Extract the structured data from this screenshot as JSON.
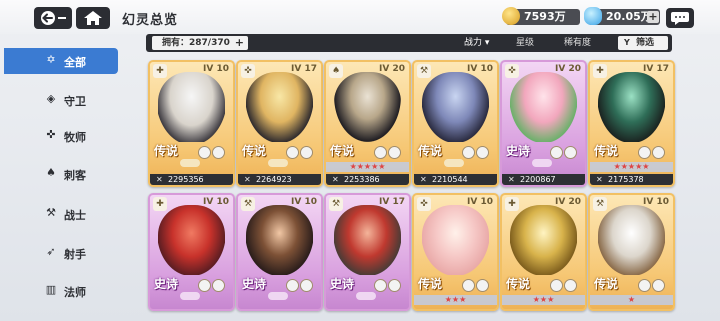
{
  "header": {
    "title": "幻灵总览",
    "gold": "7593万",
    "gems": "20.05万",
    "plus": "+"
  },
  "filter_bar": {
    "owned": "拥有：287/370",
    "owned_plus": "+",
    "power": "战力 ▾",
    "star": "星级",
    "rarity": "稀有度",
    "screen": "筛选"
  },
  "sidebar": {
    "items": [
      {
        "label": "全部",
        "icon": "✡"
      },
      {
        "label": "守卫",
        "icon": "◈"
      },
      {
        "label": "牧师",
        "icon": "✜"
      },
      {
        "label": "刺客",
        "icon": "♠"
      },
      {
        "label": "战士",
        "icon": "⚒"
      },
      {
        "label": "射手",
        "icon": "➶"
      },
      {
        "label": "法师",
        "icon": "▥"
      }
    ]
  },
  "cards": [
    {
      "level": "10",
      "rarity": "传说",
      "power": "2295356",
      "class_icon": "✚",
      "stars": ""
    },
    {
      "level": "17",
      "rarity": "传说",
      "power": "2264923",
      "class_icon": "✜",
      "stars": ""
    },
    {
      "level": "20",
      "rarity": "传说",
      "power": "2253386",
      "class_icon": "♠",
      "stars": "★★★★★"
    },
    {
      "level": "10",
      "rarity": "传说",
      "power": "2210544",
      "class_icon": "⚒",
      "stars": ""
    },
    {
      "level": "20",
      "rarity": "史诗",
      "power": "2200867",
      "class_icon": "✜",
      "stars": ""
    },
    {
      "level": "17",
      "rarity": "传说",
      "power": "2175378",
      "class_icon": "✚",
      "stars": "★★★★★"
    },
    {
      "level": "10",
      "rarity": "史诗",
      "power": "",
      "class_icon": "✚",
      "stars": ""
    },
    {
      "level": "10",
      "rarity": "史诗",
      "power": "",
      "class_icon": "⚒",
      "stars": ""
    },
    {
      "level": "17",
      "rarity": "史诗",
      "power": "",
      "class_icon": "⚒",
      "stars": ""
    },
    {
      "level": "10",
      "rarity": "传说",
      "power": "",
      "class_icon": "✜",
      "stars": "★★★"
    },
    {
      "level": "20",
      "rarity": "传说",
      "power": "",
      "class_icon": "✚",
      "stars": "★★★"
    },
    {
      "level": "10",
      "rarity": "传说",
      "power": "",
      "class_icon": "⚒",
      "stars": "★"
    }
  ],
  "icons": {
    "back": "back-arrow-icon",
    "home": "home-icon",
    "chat": "chat-icon",
    "power": "sword-icon"
  },
  "colors": {
    "legend": "#f6c774",
    "epic": "#d9a0df",
    "active_tab": "#3b7bd2",
    "dark": "#2b2d33"
  }
}
